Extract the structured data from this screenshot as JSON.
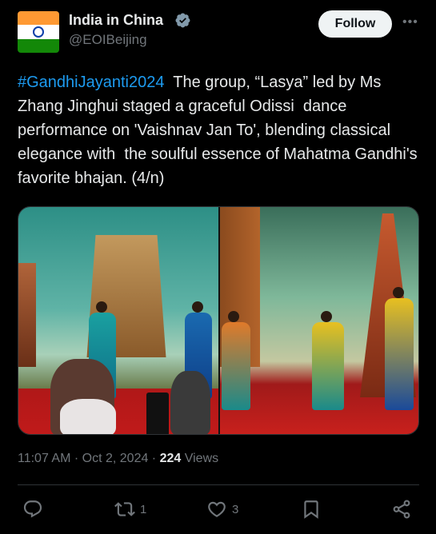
{
  "header": {
    "display_name": "India in China",
    "handle": "@EOIBeijing",
    "follow_label": "Follow",
    "more_label": "•••",
    "verified_icon": "verified-badge-icon",
    "avatar_colors": {
      "saffron": "#FF9933",
      "white": "#FFFFFF",
      "green": "#138808",
      "chakra": "#0b3ea8"
    }
  },
  "tweet": {
    "hashtag": "#GandhiJayanti2024",
    "body": "  The group, “Lasya” led by Ms Zhang Jinghui staged a graceful Odissi  dance performance on 'Vaishnav Jan To', blending classical elegance with  the soulful essence of Mahatma Gandhi's favorite bhajan. (4/n)"
  },
  "media": {
    "count": 2,
    "photos": [
      "dance-performance-photo-1",
      "dance-performance-photo-2"
    ]
  },
  "meta": {
    "time": "11:07 AM",
    "separator": " · ",
    "date": "Oct 2, 2024",
    "views_count": "224",
    "views_label": " Views"
  },
  "actions": {
    "reply_count": "",
    "repost_count": "1",
    "like_count": "3",
    "bookmark_count": "",
    "icons": [
      "reply-icon",
      "repost-icon",
      "like-icon",
      "bookmark-icon",
      "share-icon"
    ]
  },
  "colors": {
    "background": "#000000",
    "text": "#e7e9ea",
    "secondary": "#71767b",
    "link": "#1d9bf0",
    "divider": "#2f3336"
  }
}
